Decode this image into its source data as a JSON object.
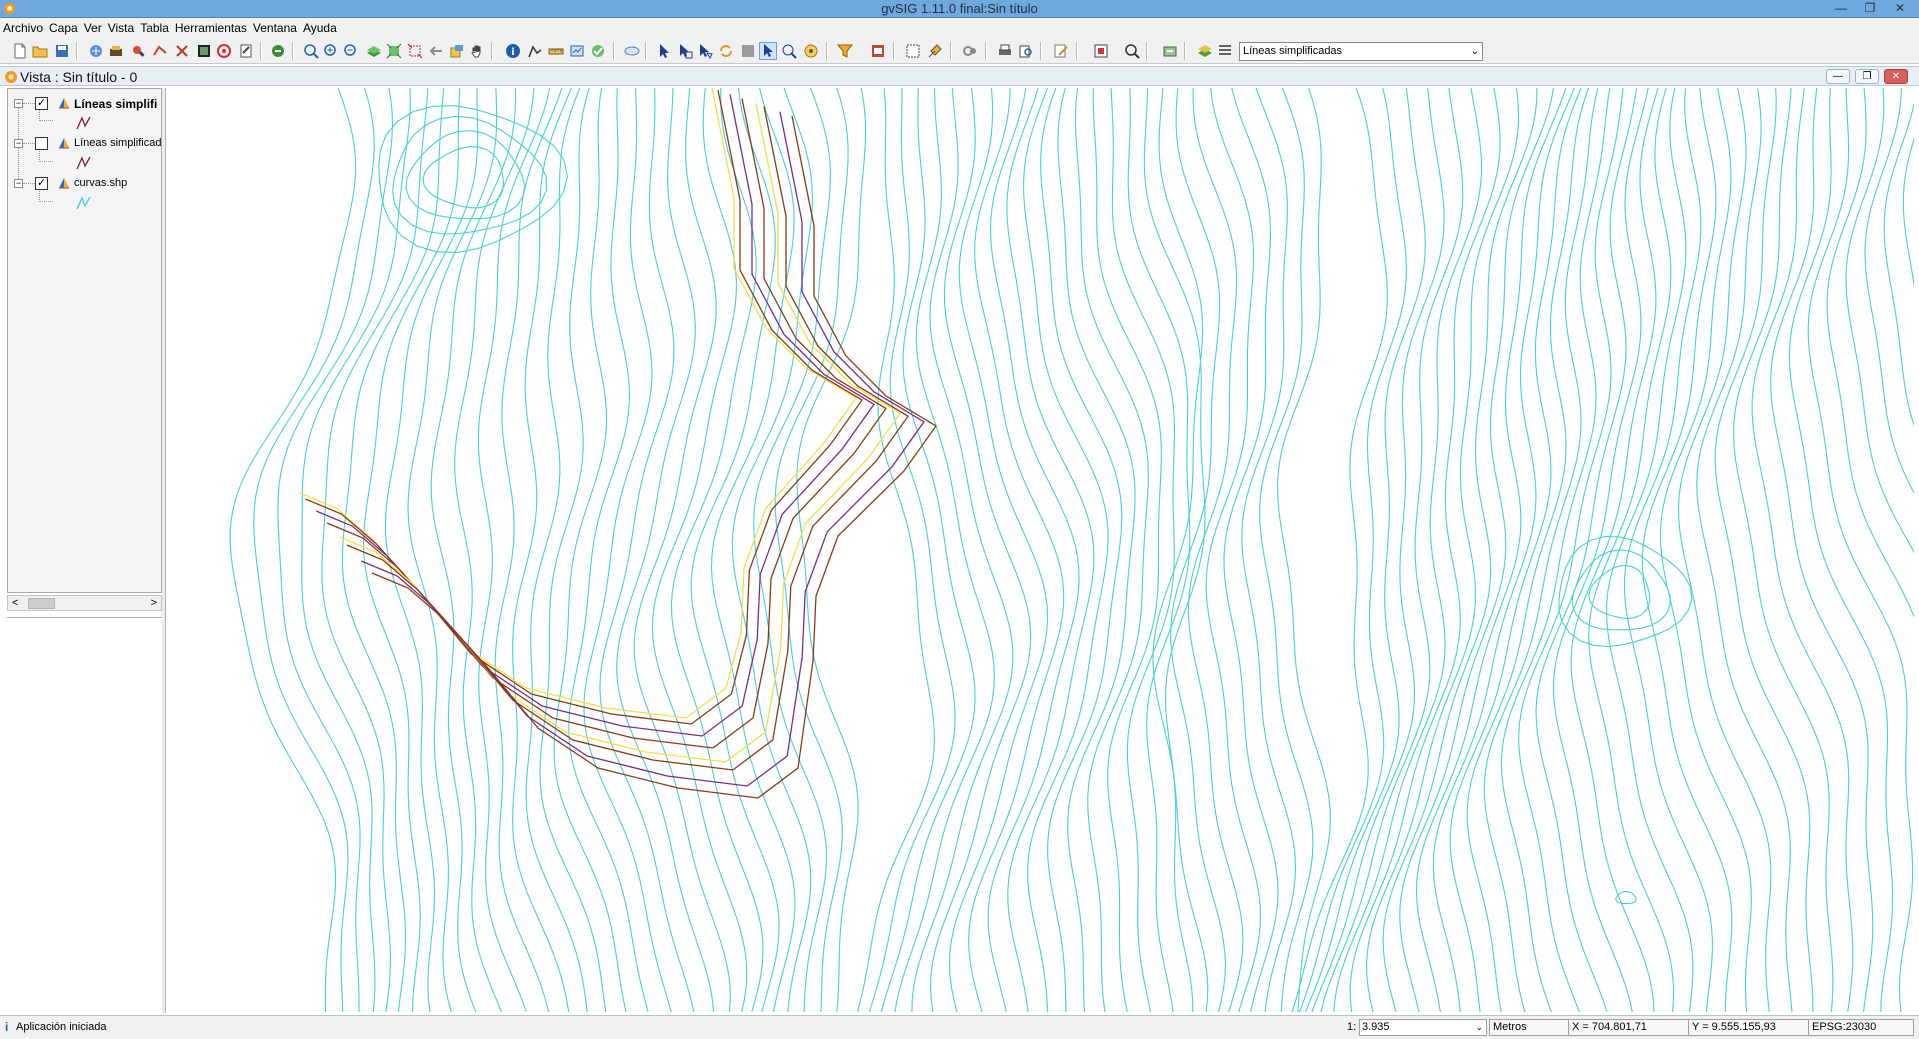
{
  "window": {
    "title": "gvSIG 1.11.0 final:Sin título",
    "minimize_glyph": "—",
    "restore_glyph": "❐",
    "close_glyph": "✕"
  },
  "menu": [
    "Archivo",
    "Capa",
    "Ver",
    "Vista",
    "Tabla",
    "Herramientas",
    "Ventana",
    "Ayuda"
  ],
  "toolbar": {
    "active_layer": "Líneas simplificadas",
    "dropdown_arrow": "⌄"
  },
  "view": {
    "title": "Vista : Sin título - 0",
    "minimize_glyph": "—",
    "restore_glyph": "❐",
    "close_glyph": "✕"
  },
  "toc": {
    "layers": [
      {
        "name": "Líneas simplifi",
        "checked": true,
        "bold": true,
        "symbol_color": "#7b1f3a",
        "check_glyph": "✓",
        "expander": "−"
      },
      {
        "name": "Líneas simplificada",
        "checked": false,
        "bold": false,
        "symbol_color": "#7b1f3a",
        "check_glyph": "",
        "expander": "−"
      },
      {
        "name": "curvas.shp",
        "checked": true,
        "bold": false,
        "symbol_color": "#3ecfe0",
        "check_glyph": "✓",
        "expander": "−"
      }
    ],
    "scroll_left": "<",
    "scroll_right": ">"
  },
  "colors": {
    "contour": "#44d0dc",
    "simplified_dark": "#8a3a12",
    "simplified_purple": "#7a2a8a",
    "simplified_yellow": "#f2e04a"
  },
  "status": {
    "icon": "i",
    "message": "Aplicación iniciada",
    "scale_prefix": "1:",
    "scale": "3.935",
    "scale_arrow": "⌄",
    "units": "Metros",
    "x": "X = 704.801,71",
    "y": "Y = 9.555.155,93",
    "crs": "EPSG:23030"
  }
}
